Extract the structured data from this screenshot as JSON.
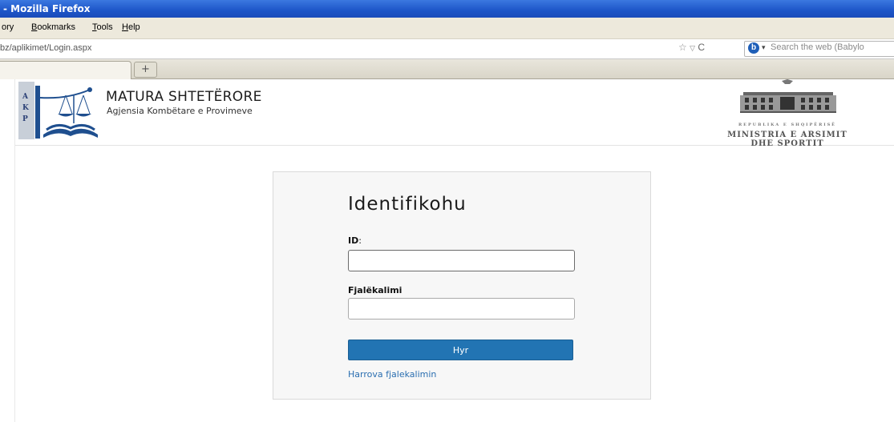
{
  "window": {
    "title": "- Mozilla Firefox"
  },
  "menu": [
    {
      "label": "ory",
      "accel": ""
    },
    {
      "label": "Bookmarks",
      "accel": "B"
    },
    {
      "label": "Tools",
      "accel": "T"
    },
    {
      "label": "Help",
      "accel": "H"
    }
  ],
  "nav": {
    "url": "bz/aplikimet/Login.aspx",
    "search_placeholder": "Search the web (Babylo"
  },
  "tabs": {
    "new_tab_label": "+"
  },
  "header": {
    "logo_letters": [
      "A",
      "K",
      "P"
    ],
    "title": "MATURA SHTETËRORE",
    "subtitle": "Agjensia Kombëtare e Provimeve",
    "ministry_line1": "REPUBLIKA E SHQIPËRISË",
    "ministry_line2": "MINISTRIA E ARSIMIT",
    "ministry_line3": "DHE SPORTIT"
  },
  "login": {
    "heading": "Identifikohu",
    "id_label": "ID",
    "id_colon": ":",
    "id_value": "",
    "password_label": "Fjalëkalimi",
    "password_value": "",
    "submit_label": "Hyr",
    "forgot_link": "Harrova fjalekalimin"
  },
  "colors": {
    "accent_button": "#2274b3",
    "link": "#2a6eb0",
    "logo_blue": "#1f4f8f"
  }
}
